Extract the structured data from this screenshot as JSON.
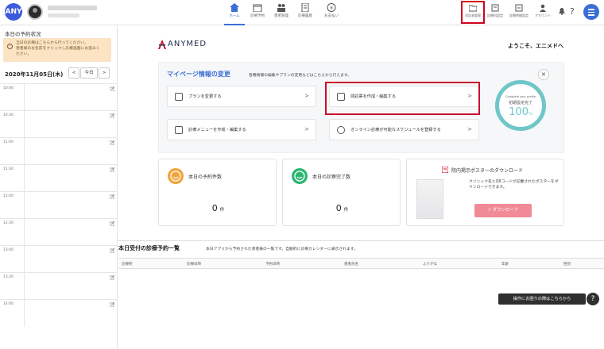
{
  "topbar": {
    "logo_text": "ANY",
    "nav": [
      {
        "label": "ホーム",
        "icon": "home-icon"
      },
      {
        "label": "診療予約",
        "icon": "calendar-icon"
      },
      {
        "label": "患者管理",
        "icon": "patients-icon"
      },
      {
        "label": "診療履歴",
        "icon": "history-icon"
      },
      {
        "label": "お支払い",
        "icon": "payment-icon"
      }
    ],
    "right_nav": [
      {
        "label": "初診表管理",
        "icon": "folder-icon"
      },
      {
        "label": "診療科設定",
        "icon": "department-icon"
      },
      {
        "label": "診療時間設定",
        "icon": "clock-icon"
      },
      {
        "label": "アカウント",
        "icon": "account-icon"
      }
    ],
    "help_symbol": "?"
  },
  "sidebar": {
    "title": "本日の予約状況",
    "warning_lines": [
      "当日の診療はこちらから行ってください。",
      "患者様のお名前をクリックし診療画面にお進みく",
      "ださい。"
    ],
    "date": "2020年11月05日(木)",
    "prev": "<",
    "today": "今日",
    "next": ">",
    "times": [
      "10:00",
      "10:30",
      "11:00",
      "11:30",
      "12:00",
      "12:30",
      "13:00",
      "13:30",
      "14:00"
    ]
  },
  "main": {
    "brand": "ANYMED",
    "welcome": "ようこそ、エニメドへ",
    "mypage": {
      "title": "マイページ情報の変更",
      "subtitle": "各種情報の編集やプランの変更などはこちらから行えます。",
      "cards": [
        {
          "label": "プランを変更する"
        },
        {
          "label": "問診票を作成・編集する"
        },
        {
          "label": "診療メニューを作成・編集する"
        },
        {
          "label": "オンライン診療が可能なスケジュールを登録する"
        }
      ],
      "arrow": ">",
      "close": "×",
      "profile": {
        "line1": "Complete your profile",
        "line2": "初期設定完了",
        "value": "100",
        "unit": "%"
      }
    },
    "stats": [
      {
        "label": "本日の予約件数",
        "value": "0",
        "unit": "件",
        "color": "#f0a43a"
      },
      {
        "label": "本日の診察完了数",
        "value": "0",
        "unit": "件",
        "color": "#2bb673"
      }
    ],
    "poster": {
      "title": "院内掲示ポスターのダウンロード",
      "desc": "クリニック名とQRコードが記載されたポスターをダウンロードできます。",
      "button": "ダウンロード"
    },
    "table": {
      "title": "本日受付の診療予約一覧",
      "subtitle": "本日アプリから予約された患者様の一覧です。自動的に診療カレンダーに表示されます。",
      "columns": [
        "診療所",
        "診療日時",
        "予約日時",
        "患者氏名",
        "ふりがな",
        "年齢",
        "性別"
      ]
    },
    "help_text": "操作にお困りの際はこちらから",
    "help_btn": "?"
  }
}
